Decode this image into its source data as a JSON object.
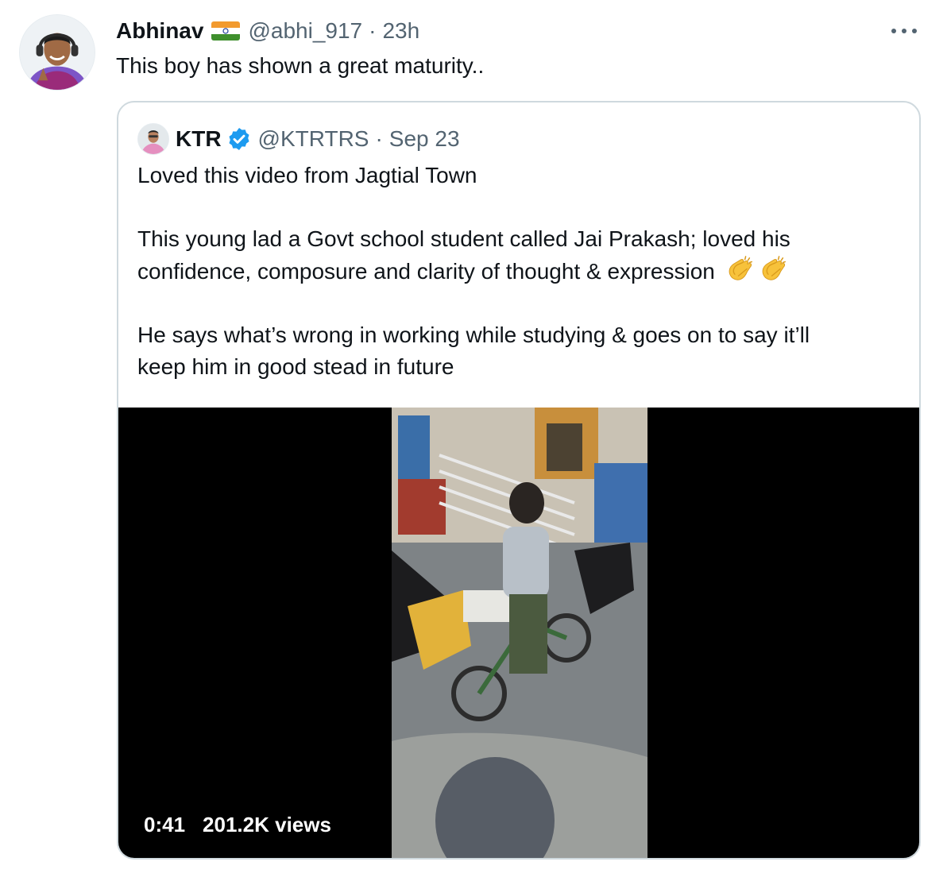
{
  "tweet": {
    "author_name": "Abhinav",
    "author_flag": "india-flag-icon",
    "handle": "@abhi_917",
    "separator": "·",
    "time": "23h",
    "text": "This boy has shown a great maturity.."
  },
  "quoted_tweet": {
    "author_name": "KTR",
    "verified": "verified-badge-icon",
    "handle": "@KTRTRS",
    "separator": "·",
    "date": "Sep 23",
    "paragraphs": [
      "Loved this video from Jagtial Town",
      "This young lad a Govt school student called Jai Prakash; loved his",
      "confidence, composure and clarity of thought & expression",
      "He says what’s wrong in working while studying & goes on to say it’ll",
      "keep him in good stead in future"
    ],
    "emoji": [
      "clapping-hands-icon",
      "clapping-hands-icon"
    ],
    "video": {
      "duration": "0:41",
      "views": "201.2K views"
    }
  },
  "colors": {
    "text": "#0f1419",
    "secondary": "#536471",
    "border": "#cfd9de",
    "verified": "#1d9bf0"
  }
}
